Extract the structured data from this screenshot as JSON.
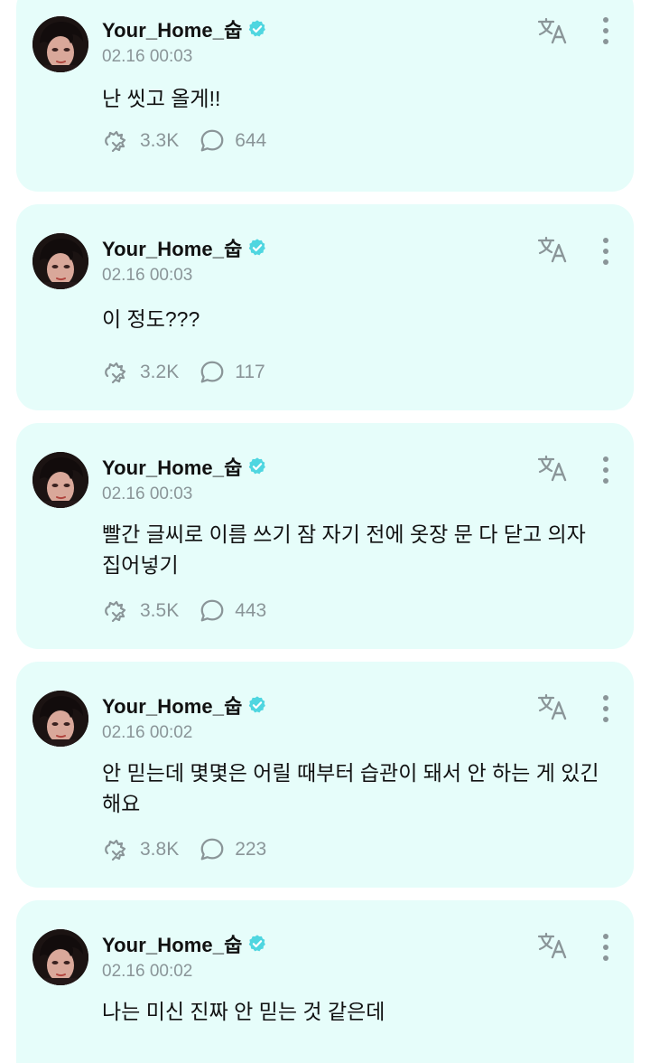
{
  "posts": [
    {
      "username": "Your_Home_숩",
      "timestamp": "02.16 00:03",
      "text": "난 씻고 올게!!",
      "repost_count": "3.3K",
      "comment_count": "644"
    },
    {
      "username": "Your_Home_숩",
      "timestamp": "02.16 00:03",
      "text": "이 정도???",
      "repost_count": "3.2K",
      "comment_count": "117"
    },
    {
      "username": "Your_Home_숩",
      "timestamp": "02.16 00:03",
      "text": "빨간 글씨로 이름 쓰기 잠 자기 전에 옷장 문 다 닫고 의자 집어넣기",
      "repost_count": "3.5K",
      "comment_count": "443"
    },
    {
      "username": "Your_Home_숩",
      "timestamp": "02.16 00:02",
      "text": "안 믿는데 몇몇은 어릴 때부터 습관이 돼서 안 하는 게 있긴 해요",
      "repost_count": "3.8K",
      "comment_count": "223"
    },
    {
      "username": "Your_Home_숩",
      "timestamp": "02.16 00:02",
      "text": "나는 미신 진짜 안 믿는 것 같은데"
    }
  ],
  "colors": {
    "card_background": "#e6fdfa",
    "verified_badge": "#4fd6e0",
    "muted_text": "#8a9598"
  },
  "icons": {
    "verified": "verified-badge-icon",
    "translate": "translate-icon",
    "more": "more-vertical-icon",
    "repost": "repost-icon",
    "comment": "comment-icon"
  }
}
